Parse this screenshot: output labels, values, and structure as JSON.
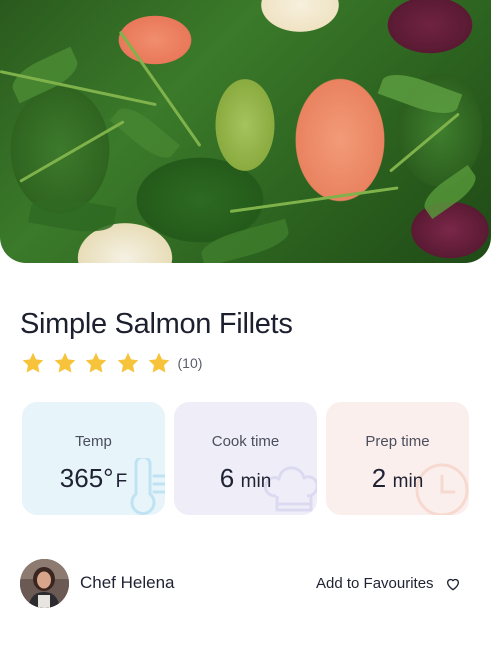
{
  "recipe": {
    "title": "Simple Salmon Fillets",
    "rating": {
      "stars": 5,
      "count_text": "(10)"
    }
  },
  "stats": [
    {
      "label": "Temp",
      "value": "365°",
      "unit": "F",
      "icon": "thermometer-icon"
    },
    {
      "label": "Cook time",
      "value": "6",
      "unit": "min",
      "icon": "chef-hat-icon"
    },
    {
      "label": "Prep time",
      "value": "2",
      "unit": "min",
      "icon": "clock-icon"
    }
  ],
  "author": {
    "name": "Chef Helena"
  },
  "actions": {
    "favourite_label": "Add to Favourites",
    "favourite_icon": "heart-icon"
  },
  "colors": {
    "star": "#F6C33A",
    "temp_card": "#E7F4FA",
    "cook_card": "#EFEEF8",
    "prep_card": "#FBEFED"
  }
}
